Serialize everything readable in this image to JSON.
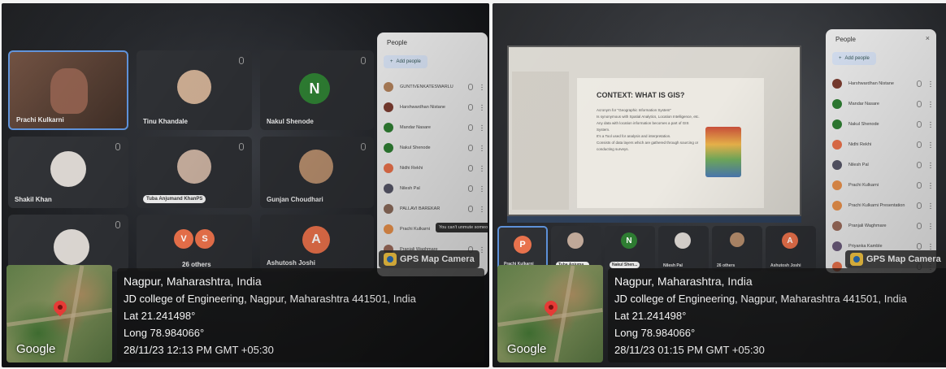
{
  "left": {
    "tiles": [
      {
        "name": "Prachi Kulkarni"
      },
      {
        "name": "Tinu Khandale"
      },
      {
        "name": "Nakul Shenode",
        "initial": "N"
      },
      {
        "name": "Shakil Khan"
      },
      {
        "name": "Tuba Anjumand KhanPS"
      },
      {
        "name": "Gunjan Choudhari"
      },
      {
        "name": ""
      },
      {
        "name": "26 others",
        "initials": [
          "V",
          "S"
        ]
      },
      {
        "name": "Ashutosh Joshi",
        "initial": "A"
      }
    ],
    "people_panel": {
      "title": "People",
      "add_label": "Add people",
      "tooltip": "You can't unmute someone",
      "participants": [
        {
          "name": "GUNTIVENKATESWARLU",
          "color": "#b0805a"
        },
        {
          "name": "Harshwardhan Nistane",
          "color": "#7a3c30"
        },
        {
          "name": "Mandar Nasare",
          "color": "#2e7d32"
        },
        {
          "name": "Nakul Shenode",
          "color": "#2e7d32"
        },
        {
          "name": "Nidhi Rekhi",
          "color": "#e8704a"
        },
        {
          "name": "Nilesh Pal",
          "color": "#555566"
        },
        {
          "name": "PALLAVI BAREKAR",
          "color": "#8a6a5a"
        },
        {
          "name": "Prachi Kulkarni",
          "color": "#e8904a"
        },
        {
          "name": "Pranjali Waghmare",
          "color": "#9a6a5a"
        }
      ]
    },
    "gps": {
      "badge": "GPS Map Camera",
      "place": "Nagpur, Maharashtra, India",
      "address": "JD college of Engineering, Nagpur, Maharashtra 441501, India",
      "lat": "Lat 21.241498°",
      "long": "Long 78.984066°",
      "datetime": "28/11/23 12:13 PM GMT +05:30",
      "map_brand": "Google"
    }
  },
  "right": {
    "slide": {
      "title": "CONTEXT:  WHAT IS GIS?",
      "bullets": [
        "Acronym for \"Geographic Information System\"",
        "Is synonymous with Spatial Analytics, Location Intelligence, etc.",
        "Any data with location information becomes a part of GIS System.",
        "It's a Tool used for analysis and interpretation.",
        "Consists of data layers which are gathered through sourcing or conducting surveys."
      ]
    },
    "strip": [
      {
        "name": "Prachi Kulkarni",
        "initial": "P"
      },
      {
        "name": "Tuba Anjuma..."
      },
      {
        "name": "Nakul Shen...",
        "initial": "N"
      },
      {
        "name": "Nilesh Pal"
      },
      {
        "name": "26 others"
      },
      {
        "name": "Ashutosh Joshi",
        "initial": "A"
      }
    ],
    "people_panel": {
      "title": "People",
      "add_label": "Add people",
      "participants": [
        {
          "name": "Harshwardhan Nistane",
          "color": "#7a3c30"
        },
        {
          "name": "Mandar Nasare",
          "color": "#2e7d32"
        },
        {
          "name": "Nakul Shenode",
          "color": "#2e7d32"
        },
        {
          "name": "Nidhi Rekhi",
          "color": "#e8704a"
        },
        {
          "name": "Nilesh Pal",
          "color": "#555566"
        },
        {
          "name": "Prachi Kulkarni",
          "color": "#e8904a"
        },
        {
          "name": "Prachi Kulkarni Presentation",
          "color": "#e8904a"
        },
        {
          "name": "Pranjali Waghmare",
          "color": "#9a6a5a"
        },
        {
          "name": "Priyanka Kamble",
          "color": "#6a5a7a"
        },
        {
          "name": "R",
          "color": "#e8704a"
        }
      ]
    },
    "gps": {
      "badge": "GPS Map Camera",
      "place": "Nagpur, Maharashtra, India",
      "address": "JD college of Engineering, Nagpur, Maharashtra 441501, India",
      "lat": "Lat 21.241498°",
      "long": "Long 78.984066°",
      "datetime": "28/11/23 01:15 PM GMT +05:30",
      "map_brand": "Google"
    }
  }
}
